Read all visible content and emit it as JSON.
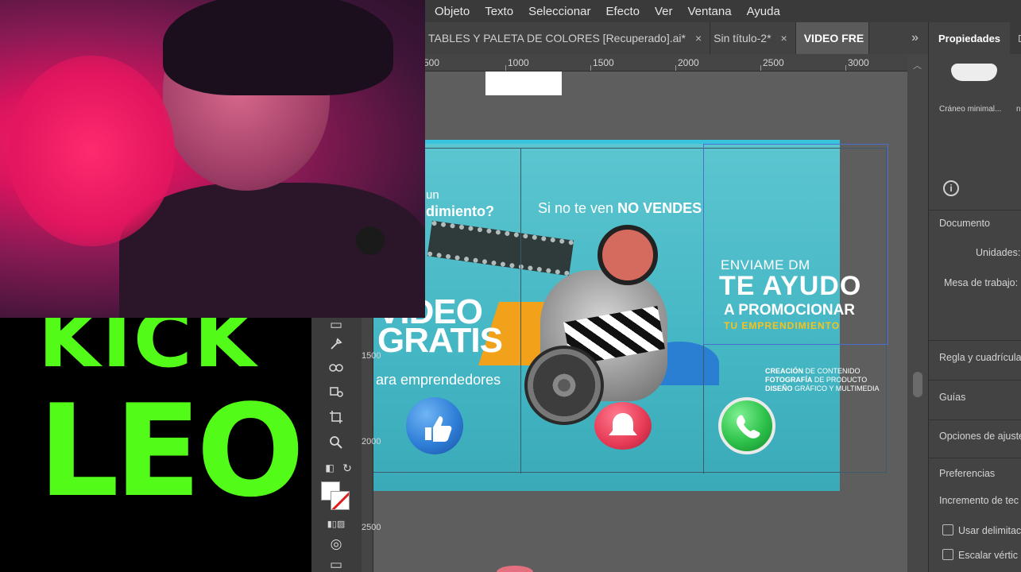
{
  "menu": {
    "items": [
      "Objeto",
      "Texto",
      "Seleccionar",
      "Efecto",
      "Ver",
      "Ventana",
      "Ayuda"
    ]
  },
  "tabs": {
    "items": [
      {
        "label": "TABLES Y PALETA DE COLORES [Recuperado].ai*",
        "close": "×"
      },
      {
        "label": "Sin título-2*",
        "close": "×"
      },
      {
        "label": "VIDEO FRE",
        "close": ""
      }
    ],
    "overflow": "»"
  },
  "ruler": {
    "h_ticks": [
      "500",
      "1000",
      "1500",
      "2000",
      "2500",
      "3000"
    ],
    "v_ticks": [
      "1500",
      "2000",
      "2500"
    ]
  },
  "artboard": {
    "pregunta_small": "un",
    "pregunta": "dimiento?",
    "sinote_normal": "Si no te ven",
    "sinote_bold": "NO VENDES",
    "video": "VIDEO",
    "gratis": "GRATIS",
    "emprendedores": "ara emprendedores",
    "enviame": "ENVIAME DM",
    "ayudo": "TE AYUDO",
    "promocionar": "A PROMOCIONAR",
    "emprendimiento": "TU EMPRENDIMIENTO",
    "creacion_bold": "CREACIÓN",
    "creacion_rest": "DE CONTENIDO",
    "foto_bold": "FOTOGRAFÍA",
    "foto_rest": "DE PRODUCTO",
    "diseno_bold": "DISEÑO",
    "diseno_rest": "GRÁFICO Y MULTIMEDIA"
  },
  "properties": {
    "tab_active": "Propiedades",
    "tab_other": "D",
    "item_name": "Cráneo minimal...",
    "item_extra": "n",
    "documento": "Documento",
    "unidades": "Unidades:",
    "mesa": "Mesa de trabajo:",
    "regla": "Regla y cuadrícula",
    "guias": "Guías",
    "opciones": "Opciones de ajuste",
    "preferencias": "Preferencias",
    "incremento": "Incremento de tec",
    "usar": "Usar delimitac",
    "escalar": "Escalar vértic"
  },
  "logo": {
    "line1": "KICK",
    "line2": "LEO"
  },
  "colors": {
    "kick_green": "#53fc18",
    "artboard_teal": "#4ebfcb",
    "accent_yellow": "#f7c31a"
  }
}
